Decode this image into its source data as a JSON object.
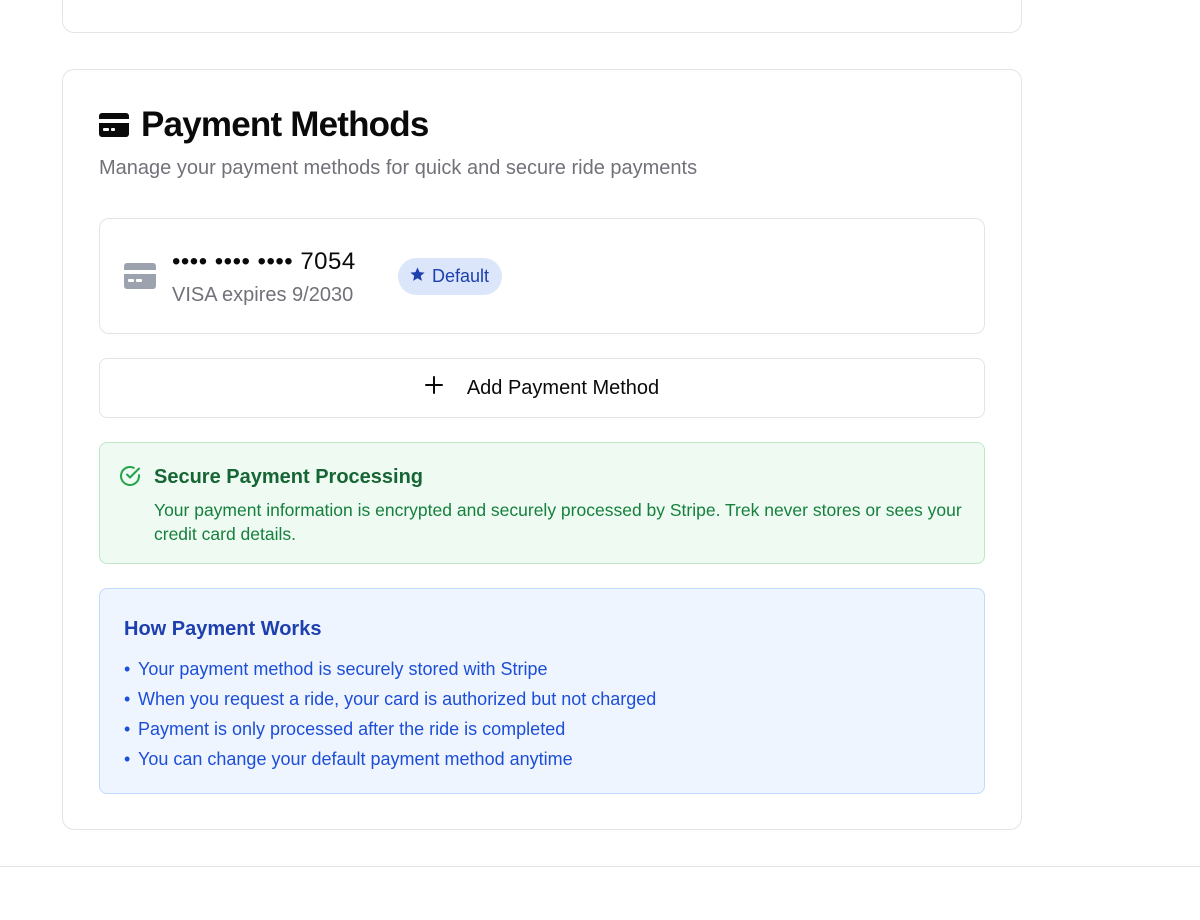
{
  "payment_methods": {
    "title": "Payment Methods",
    "subtitle": "Manage your payment methods for quick and secure ride payments",
    "header_icon": "credit-card-icon",
    "methods": [
      {
        "masked_number": "•••• •••• •••• 7054",
        "details": "VISA expires 9/2030",
        "badge": "Default",
        "badge_icon": "star-icon",
        "icon": "credit-card-icon"
      }
    ],
    "add_button": {
      "label": "Add Payment Method",
      "icon": "plus-icon"
    },
    "secure_notice": {
      "icon": "check-circle-icon",
      "title": "Secure Payment Processing",
      "text": "Your payment information is encrypted and securely processed by Stripe. Trek never stores or sees your credit card details."
    },
    "how_it_works": {
      "title": "How Payment Works",
      "items": [
        "Your payment method is securely stored with Stripe",
        "When you request a ride, your card is authorized but not charged",
        "Payment is only processed after the ride is completed",
        "You can change your default payment method anytime"
      ]
    }
  },
  "colors": {
    "accent_blue": "#1e40af",
    "badge_bg": "#dbe6fb",
    "success_green": "#166534",
    "success_bg": "#effbf2",
    "info_bg": "#eff5fe",
    "border": "#e4e4e7",
    "muted_text": "#71717a"
  }
}
